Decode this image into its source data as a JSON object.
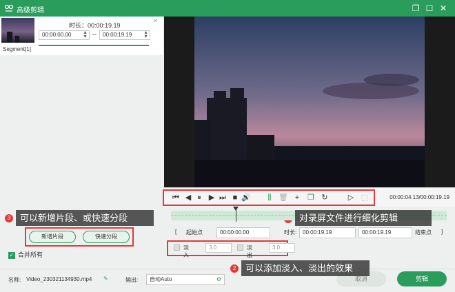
{
  "window": {
    "title": "高级剪辑"
  },
  "segment": {
    "name": "Segment[1]",
    "duration_label": "时长：00:00:19.19",
    "start_time": "00:00:00.00",
    "end_time": "00:00:19.19",
    "separator": "--"
  },
  "annotations": {
    "one": {
      "num": "1",
      "text": "对录屏文件进行细化剪辑"
    },
    "two": {
      "num": "2",
      "text": "可以添加淡入、淡出的效果"
    },
    "three": {
      "num": "3",
      "text": "可以新增片段、或快速分段"
    }
  },
  "left_actions": {
    "add_segment": "新增片段",
    "quick_split": "快速分段"
  },
  "merge_all": "合并所有",
  "player": {
    "time_readout": "00:00:04.13/00:00:19.19"
  },
  "range": {
    "start_label": "起始点",
    "start_value": "00:00:00.00",
    "duration_label": "时长:",
    "duration_value": "00:00:19.19",
    "end_value": "00:00:19.19",
    "end_label": "结束点"
  },
  "fade": {
    "in_label": "淡入",
    "in_value": "3.0",
    "out_label": "淡出",
    "out_value": "3.0"
  },
  "bottom": {
    "name_label": "名称:",
    "file_name": "Video_230321134930.mp4",
    "output_label": "输出:",
    "output_value": "自动Auto",
    "cancel_label": "取消",
    "edit_label": "剪辑"
  },
  "colors": {
    "accent": "#2a9d5c",
    "annotation_red": "#e53935"
  }
}
